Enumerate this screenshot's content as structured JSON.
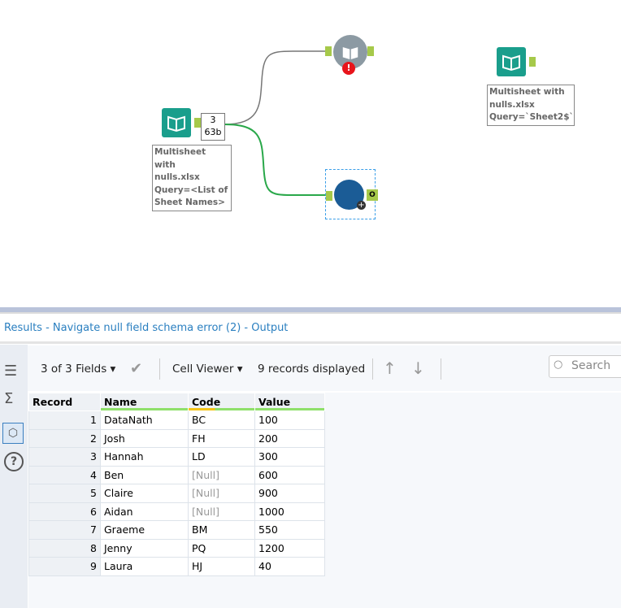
{
  "canvas": {
    "input_tool": {
      "badge_count": "3",
      "badge_size": "63b",
      "annotation": [
        "Multisheet with",
        "nulls.xlsx",
        "Query=<List of",
        "Sheet Names>"
      ]
    },
    "second_input": {
      "annotation": [
        "Multisheet with",
        "nulls.xlsx",
        "Query=`Sheet2$`"
      ]
    },
    "dynamic_input": {
      "error_icon": "!"
    },
    "macro_output_label": "O"
  },
  "results": {
    "title": "Results - Navigate null field schema error (2) - Output",
    "fields_label": "3 of 3 Fields",
    "viewer_label": "Cell Viewer",
    "records_label": "9 records displayed",
    "search_placeholder": "Search",
    "columns": [
      "Record",
      "Name",
      "Code",
      "Value"
    ],
    "rows": [
      [
        "1",
        "DataNath",
        "BC",
        "100"
      ],
      [
        "2",
        "Josh",
        "FH",
        "200"
      ],
      [
        "3",
        "Hannah",
        "LD",
        "300"
      ],
      [
        "4",
        "Ben",
        "[Null]",
        "600"
      ],
      [
        "5",
        "Claire",
        "[Null]",
        "900"
      ],
      [
        "6",
        "Aidan",
        "[Null]",
        "1000"
      ],
      [
        "7",
        "Graeme",
        "BM",
        "550"
      ],
      [
        "8",
        "Jenny",
        "PQ",
        "1200"
      ],
      [
        "9",
        "Laura",
        "HJ",
        "40"
      ]
    ]
  },
  "colors": {
    "accent": "#2a7fc0",
    "tool_teal": "#1a9e8c",
    "macro_blue": "#1b5c96",
    "connector": "#a6c94a"
  }
}
